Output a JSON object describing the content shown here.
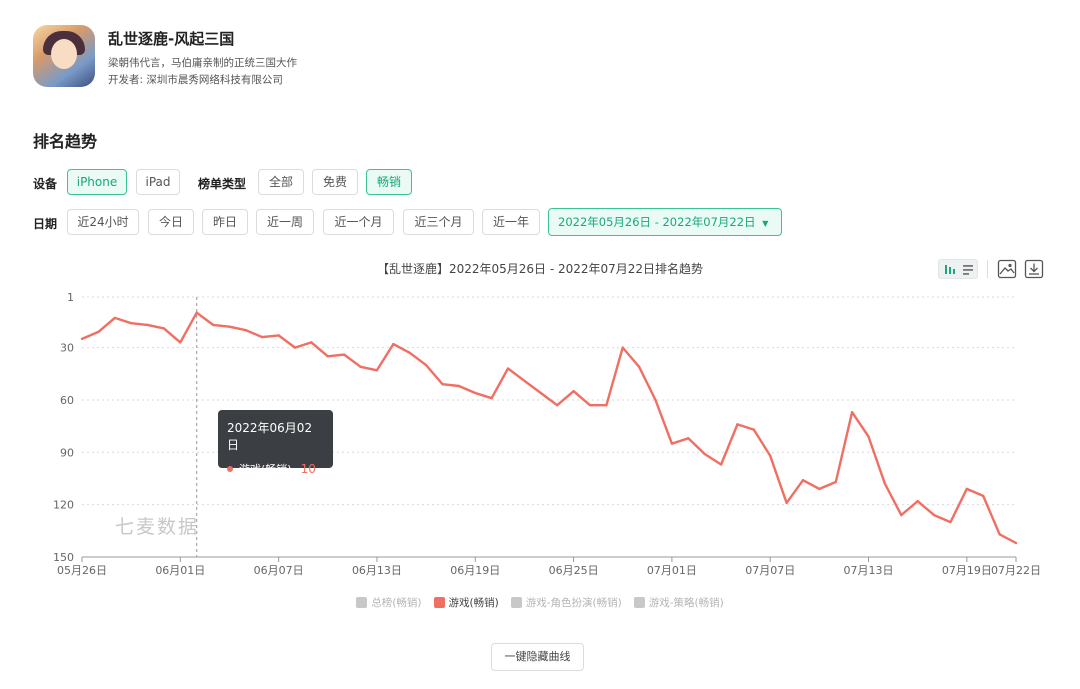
{
  "app": {
    "name": "乱世逐鹿-风起三国",
    "description": "梁朝伟代言，马伯庸亲制的正统三国大作",
    "developer": "开发者: 深圳市晨秀网络科技有限公司"
  },
  "section_title": "排名趋势",
  "filters": {
    "device_label": "设备",
    "devices": [
      "iPhone",
      "iPad"
    ],
    "active_device": "iPhone",
    "list_type_label": "榜单类型",
    "list_types": [
      "全部",
      "免费",
      "畅销"
    ],
    "active_list_type": "畅销",
    "date_label": "日期",
    "date_options": [
      "近24小时",
      "今日",
      "昨日",
      "近一周",
      "近一个月",
      "近三个月",
      "近一年"
    ],
    "date_range": "2022年05月26日 - 2022年07月22日"
  },
  "colors": {
    "accent": "#1aa77c",
    "series": "#f06f63",
    "inactive": "#c8c8c8"
  },
  "tooltip": {
    "date": "2022年06月02日",
    "series": "游戏(畅销)",
    "value": "10"
  },
  "watermark": "七麦数据",
  "hide_button": "一键隐藏曲线",
  "chart_data": {
    "type": "line",
    "title": "【乱世逐鹿】2022年05月26日 - 2022年07月22日排名趋势",
    "y_inverted": true,
    "ylim": [
      1,
      150
    ],
    "yticks": [
      1,
      30,
      60,
      90,
      120,
      150
    ],
    "x_tick_labels": [
      "05月26日",
      "06月01日",
      "06月07日",
      "06月13日",
      "06月19日",
      "06月25日",
      "07月01日",
      "07月07日",
      "07月13日",
      "07月19日",
      "07月22日"
    ],
    "x_tick_index": [
      0,
      6,
      12,
      18,
      24,
      30,
      36,
      42,
      48,
      54,
      57
    ],
    "legend": [
      {
        "name": "总榜(畅销)",
        "active": false
      },
      {
        "name": "游戏(畅销)",
        "active": true
      },
      {
        "name": "游戏-角色扮演(畅销)",
        "active": false
      },
      {
        "name": "游戏-策略(畅销)",
        "active": false
      }
    ],
    "series": [
      {
        "name": "游戏(畅销)",
        "x": [
          "05月26日",
          "05月27日",
          "05月28日",
          "05月29日",
          "05月30日",
          "05月31日",
          "06月01日",
          "06月02日",
          "06月03日",
          "06月04日",
          "06月05日",
          "06月06日",
          "06月07日",
          "06月08日",
          "06月09日",
          "06月10日",
          "06月11日",
          "06月12日",
          "06月13日",
          "06月14日",
          "06月15日",
          "06月16日",
          "06月17日",
          "06月18日",
          "06月19日",
          "06月20日",
          "06月21日",
          "06月22日",
          "06月23日",
          "06月24日",
          "06月25日",
          "06月26日",
          "06月27日",
          "06月28日",
          "06月29日",
          "06月30日",
          "07月01日",
          "07月02日",
          "07月03日",
          "07月04日",
          "07月05日",
          "07月06日",
          "07月07日",
          "07月08日",
          "07月09日",
          "07月10日",
          "07月11日",
          "07月12日",
          "07月13日",
          "07月14日",
          "07月15日",
          "07月16日",
          "07月17日",
          "07月18日",
          "07月19日",
          "07月20日",
          "07月21日",
          "07月22日"
        ],
        "values": [
          25,
          21,
          13,
          16,
          17,
          19,
          27,
          10,
          17,
          18,
          20,
          24,
          23,
          30,
          27,
          35,
          34,
          41,
          43,
          28,
          33,
          40,
          51,
          52,
          56,
          59,
          42,
          49,
          56,
          63,
          55,
          63,
          63,
          30,
          41,
          60,
          85,
          82,
          91,
          97,
          74,
          77,
          92,
          119,
          106,
          111,
          107,
          67,
          81,
          108,
          126,
          118,
          126,
          130,
          111,
          115,
          137,
          142
        ]
      }
    ]
  }
}
